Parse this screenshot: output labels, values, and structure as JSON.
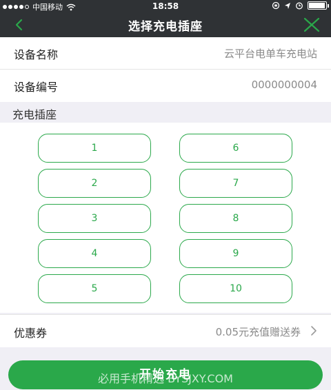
{
  "status_bar": {
    "carrier": "中国移动",
    "time": "18:58",
    "battery_level": 0.95
  },
  "nav": {
    "title": "选择充电插座",
    "back_icon": "chevron-left-icon",
    "close_icon": "close-icon"
  },
  "device": {
    "name_label": "设备名称",
    "name_value": "云平台电单车充电站",
    "id_label": "设备编号",
    "id_value": "0000000004"
  },
  "sockets": {
    "section_label": "充电插座",
    "left": [
      "1",
      "2",
      "3",
      "4",
      "5"
    ],
    "right": [
      "6",
      "7",
      "8",
      "9",
      "10"
    ]
  },
  "coupon": {
    "label": "优惠券",
    "value": "0.05元充值赠送券"
  },
  "action": {
    "start_label": "开始充电"
  },
  "watermark": "必用手机精选  BYSJXY.COM",
  "colors": {
    "accent": "#2aa84a",
    "nav_bg": "#2f3235",
    "page_bg": "#f0eff5"
  }
}
